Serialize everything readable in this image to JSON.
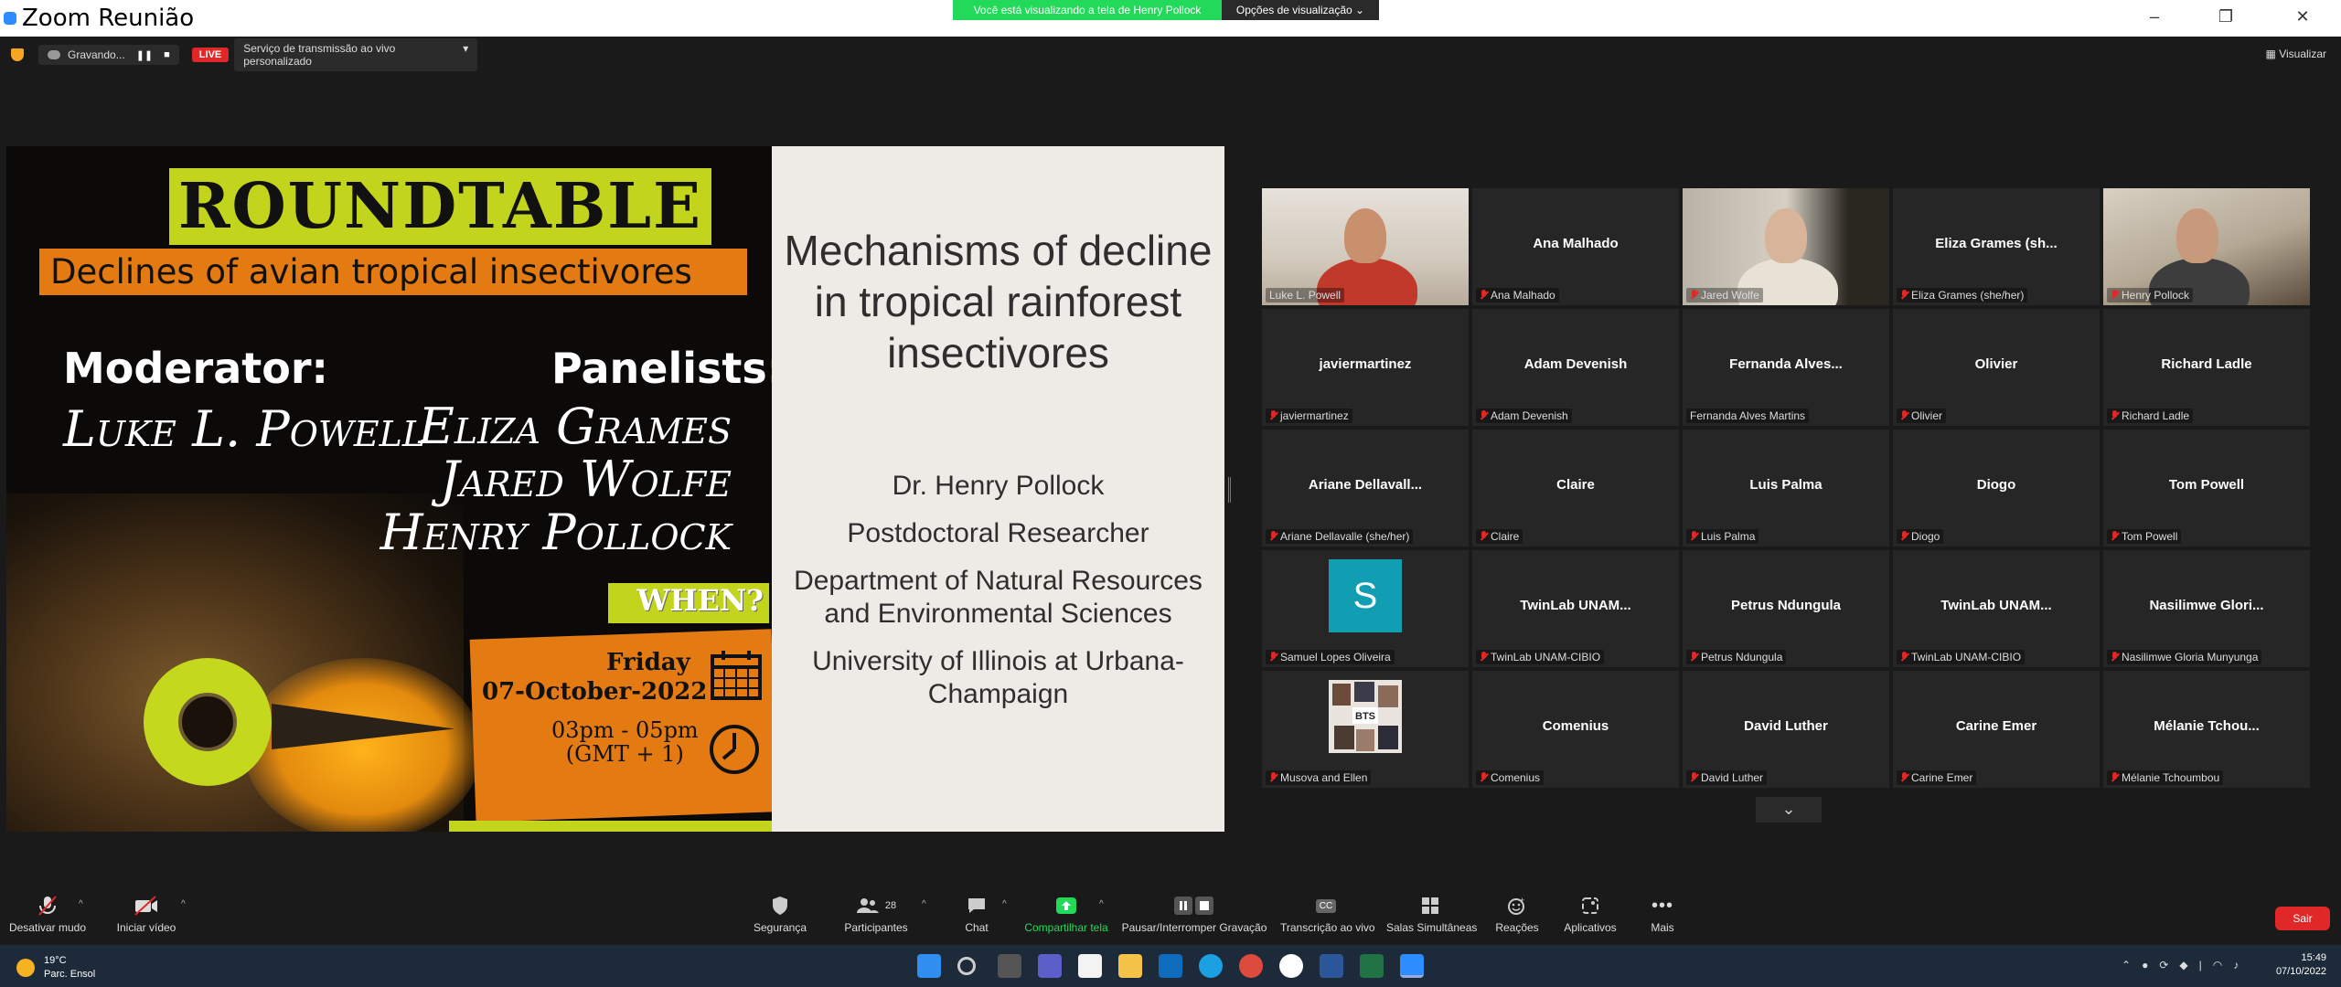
{
  "window": {
    "title": "Zoom Reunião",
    "viewing_banner": "Você está visualizando a tela de Henry Pollock",
    "view_options": "Opções de visualização"
  },
  "recording": {
    "status": "Gravando...",
    "live": "LIVE",
    "stream_service": "Serviço de transmissão ao vivo personalizado",
    "view_label": "Visualizar"
  },
  "poster": {
    "title": "ROUNDTABLE",
    "subtitle": "Declines of avian tropical insectivores",
    "moderator_label": "Moderator:",
    "moderator": "Luke L. Powell",
    "panelists_label": "Panelists:",
    "panelists": [
      "Eliza Grames",
      "Jared Wolfe",
      "Henry Pollock"
    ],
    "when_label": "WHEN?",
    "day": "Friday",
    "date": "07-October-2022",
    "time": "03pm - 05pm",
    "timezone": "(GMT + 1)"
  },
  "slide_text": {
    "title": "Mechanisms of decline in tropical rainforest insectivores",
    "presenter": "Dr. Henry Pollock",
    "role": "Postdoctoral Researcher",
    "department": "Department of Natural Resources and Environmental Sciences",
    "university": "University of Illinois at Urbana-Champaign"
  },
  "participants": [
    {
      "center": "",
      "label": "Luke L. Powell",
      "video": "luke",
      "muted": false,
      "active": true
    },
    {
      "center": "Ana Malhado",
      "label": "Ana Malhado",
      "muted": true
    },
    {
      "center": "",
      "label": "Jared Wolfe",
      "video": "jared",
      "muted": true
    },
    {
      "center": "Eliza Grames (sh...",
      "label": "Eliza Grames (she/her)",
      "muted": true
    },
    {
      "center": "",
      "label": "Henry Pollock",
      "video": "henry",
      "muted": true
    },
    {
      "center": "javiermartinez",
      "label": "javiermartinez",
      "muted": true
    },
    {
      "center": "Adam Devenish",
      "label": "Adam Devenish",
      "muted": true
    },
    {
      "center": "Fernanda Alves...",
      "label": "Fernanda Alves Martins",
      "muted": false
    },
    {
      "center": "Olivier",
      "label": "Olivier",
      "muted": true
    },
    {
      "center": "Richard Ladle",
      "label": "Richard Ladle",
      "muted": true
    },
    {
      "center": "Ariane Dellavall...",
      "label": "Ariane Dellavalle (she/her)",
      "muted": true
    },
    {
      "center": "Claire",
      "label": "Claire",
      "muted": true
    },
    {
      "center": "Luis Palma",
      "label": "Luis Palma",
      "muted": true
    },
    {
      "center": "Diogo",
      "label": "Diogo",
      "muted": true
    },
    {
      "center": "Tom Powell",
      "label": "Tom Powell",
      "muted": true
    },
    {
      "center": "",
      "label": "Samuel Lopes Oliveira",
      "avatar": "S",
      "muted": true
    },
    {
      "center": "TwinLab UNAM...",
      "label": "TwinLab UNAM-CIBIO",
      "muted": true
    },
    {
      "center": "Petrus Ndungula",
      "label": "Petrus Ndungula",
      "muted": true
    },
    {
      "center": "TwinLab UNAM...",
      "label": "TwinLab UNAM-CIBIO",
      "muted": true
    },
    {
      "center": "Nasilimwe Glori...",
      "label": "Nasilimwe Gloria Munyunga",
      "muted": true
    },
    {
      "center": "",
      "label": "Musova and Ellen",
      "avatar": "BTS",
      "muted": true
    },
    {
      "center": "Comenius",
      "label": "Comenius",
      "muted": true
    },
    {
      "center": "David Luther",
      "label": "David Luther",
      "muted": true
    },
    {
      "center": "Carine Emer",
      "label": "Carine Emer",
      "muted": true
    },
    {
      "center": "Mélanie Tchou...",
      "label": "Mélanie Tchoumbou",
      "muted": true
    }
  ],
  "toolbar": {
    "mute": "Desativar mudo",
    "video": "Iniciar vídeo",
    "security": "Segurança",
    "participants": "Participantes",
    "participants_count": "28",
    "chat": "Chat",
    "share": "Compartilhar tela",
    "record": "Pausar/Interromper Gravação",
    "transcript": "Transcrição ao vivo",
    "breakout": "Salas Simultâneas",
    "reactions": "Reações",
    "apps": "Aplicativos",
    "more": "Mais",
    "leave": "Sair",
    "cc": "CC"
  },
  "taskbar": {
    "temperature": "19°C",
    "weather": "Parc. Ensol",
    "time": "15:49",
    "date": "07/10/2022"
  },
  "colors": {
    "accent_green": "#23d959",
    "live_red": "#e02828",
    "active_border": "#c5e630",
    "poster_yellow": "#c2d41c",
    "poster_orange": "#e37a12"
  }
}
